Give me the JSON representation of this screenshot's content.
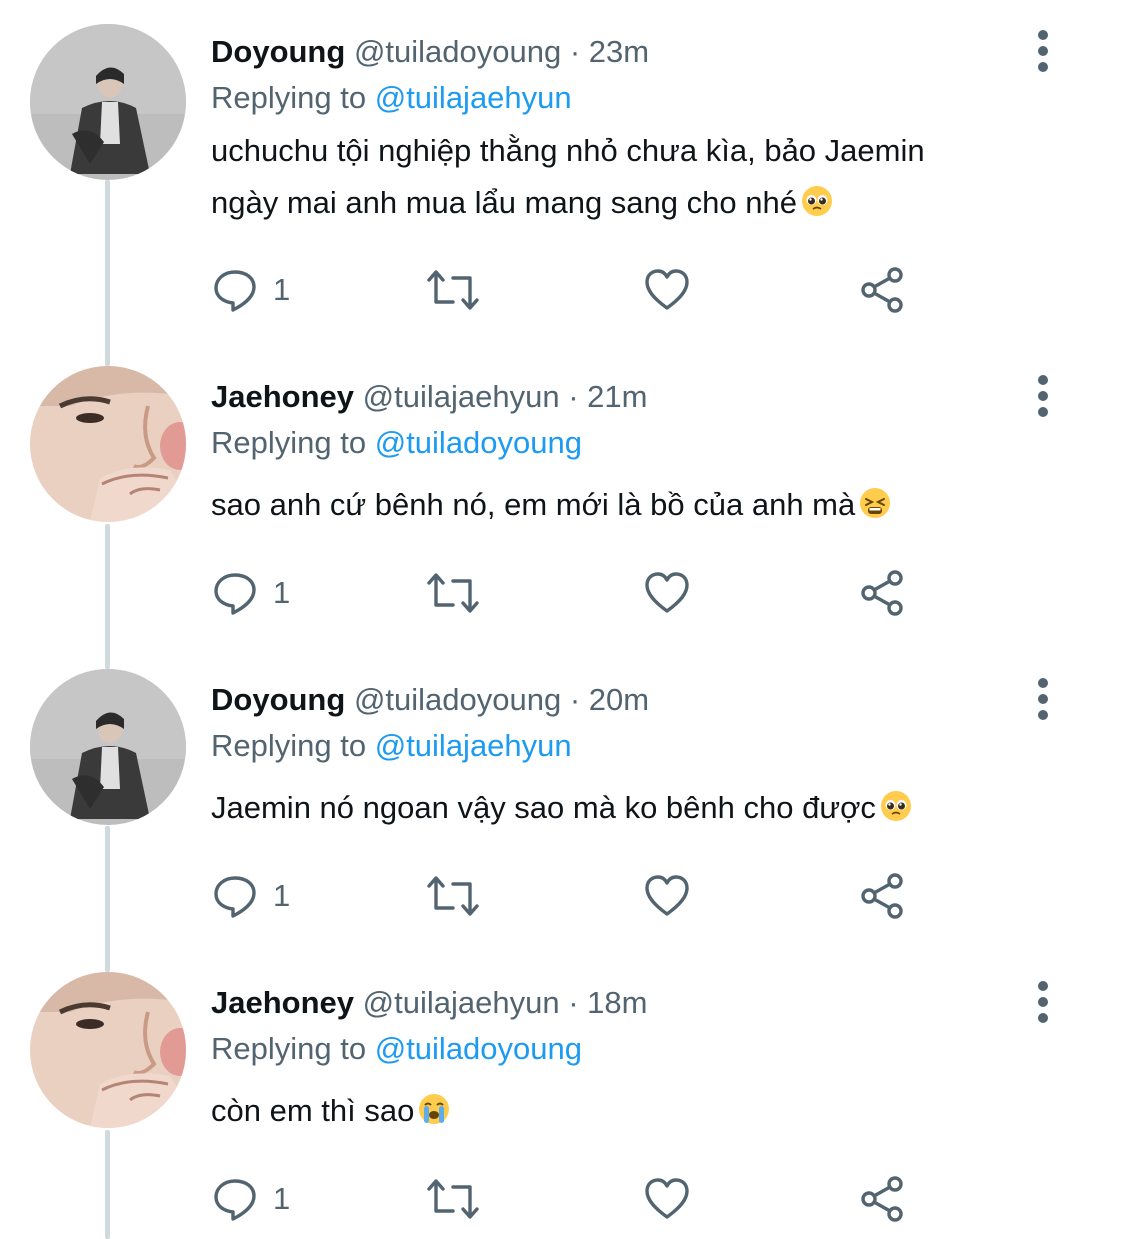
{
  "tweets": [
    {
      "display_name": "Doyoung",
      "handle": "@tuiladoyoung",
      "time": "· 23m",
      "replying_prefix": "Replying to",
      "replying_handle": "@tuilajaehyun",
      "text_lines": [
        "uchuchu tội nghiệp thằng nhỏ chưa kìa, bảo Jaemin",
        "ngày mai anh mua lẩu mang sang cho nhé"
      ],
      "emoji": "pleading-face",
      "reply_count": "1",
      "avatar": "doyoung"
    },
    {
      "display_name": "Jaehoney",
      "handle": "@tuilajaehyun",
      "time": "· 21m",
      "replying_prefix": "Replying to",
      "replying_handle": "@tuiladoyoung",
      "text_lines": [
        "sao anh cứ bênh nó, em mới là bồ của anh mà"
      ],
      "emoji": "tired-face",
      "reply_count": "1",
      "avatar": "jaehyun"
    },
    {
      "display_name": "Doyoung",
      "handle": "@tuiladoyoung",
      "time": "· 20m",
      "replying_prefix": "Replying to",
      "replying_handle": "@tuilajaehyun",
      "text_lines": [
        "Jaemin nó ngoan vậy sao mà ko bênh cho được"
      ],
      "emoji": "pleading-face",
      "reply_count": "1",
      "avatar": "doyoung"
    },
    {
      "display_name": "Jaehoney",
      "handle": "@tuilajaehyun",
      "time": "· 18m",
      "replying_prefix": "Replying to",
      "replying_handle": "@tuiladoyoung",
      "text_lines": [
        "còn em thì sao"
      ],
      "emoji": "loudly-crying-face",
      "reply_count": "1",
      "avatar": "jaehyun"
    }
  ],
  "icons": {
    "reply": "reply-icon",
    "retweet": "retweet-icon",
    "like": "heart-icon",
    "share": "share-icon",
    "more": "more-options-icon"
  },
  "colors": {
    "text": "#0f1419",
    "secondary": "#536471",
    "link": "#1d9bf0",
    "thread_line": "#cfd9de"
  }
}
